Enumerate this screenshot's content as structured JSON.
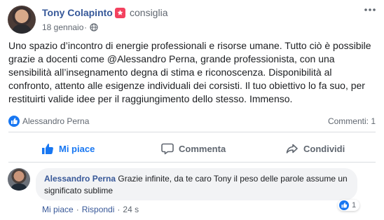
{
  "post": {
    "author": "Tony Colapinto",
    "recommend_icon": "star-flag-icon",
    "recommend_text": "consiglia",
    "date": "18 gennaio",
    "separator": "·",
    "privacy_icon": "globe-icon",
    "more_icon": "more-dots-icon",
    "text_lines": [
      "Uno spazio d’incontro di energie professionali e risorse umane. Tutto ciò è possibile",
      "grazie a docenti come @Alessandro Perna, grande professionista, con una",
      "sensibilità all’insegnamento degna di stima e riconoscenza. Disponibilità al",
      "confronto, attento alle esigenze individuali dei corsisti. Il tuo obiettivo lo fa suo, per",
      "restituirti valide idee per il raggiungimento dello stesso. Immenso."
    ]
  },
  "reactions": {
    "reactor": "Alessandro Perna",
    "comment_count": "Commenti: 1"
  },
  "actions": {
    "like": "Mi piace",
    "comment": "Commenta",
    "share": "Condividi"
  },
  "comment": {
    "author": "Alessandro Perna",
    "text": "Grazie infinite, da te caro Tony il peso delle parole assume un significato sublime",
    "like_count": "1",
    "like_link": "Mi piace",
    "reply_link": "Rispondi",
    "time": "24 s",
    "separator": "·"
  },
  "colors": {
    "link_blue": "#365899",
    "facebook_blue": "#1877f2",
    "recommend_red": "#f3425f",
    "muted_text": "#606770",
    "bubble_bg": "#f2f3f5"
  }
}
